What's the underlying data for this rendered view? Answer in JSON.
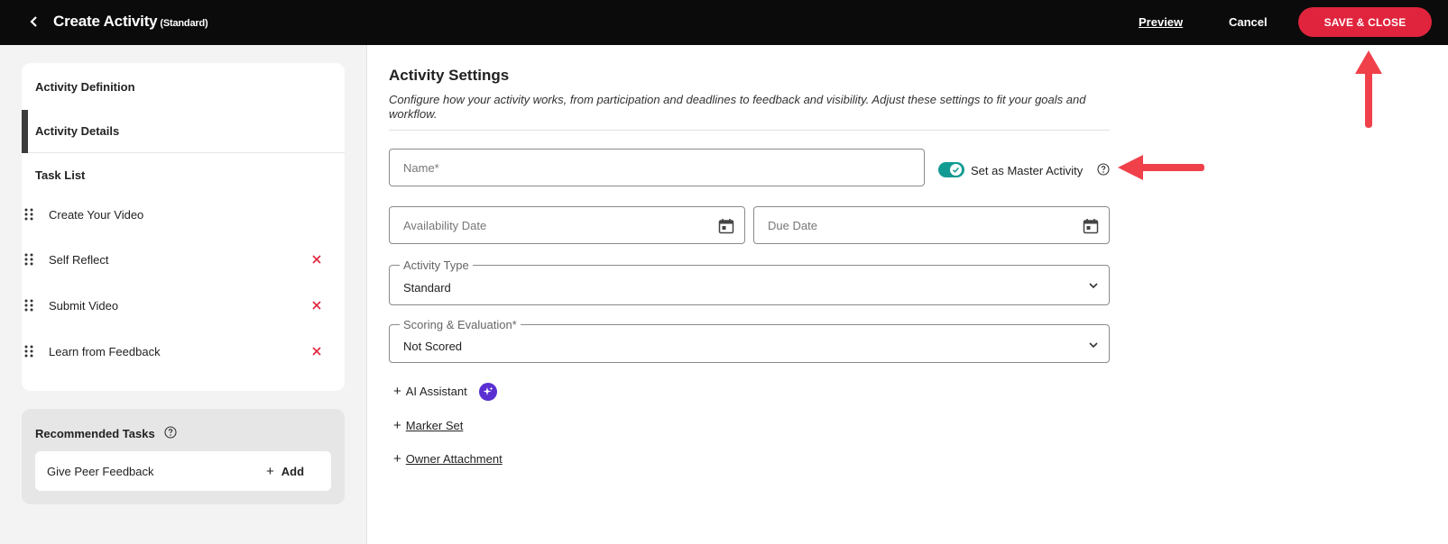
{
  "header": {
    "title": "Create Activity",
    "title_sub": "(Standard)",
    "preview_label": "Preview",
    "cancel_label": "Cancel",
    "save_label": "SAVE & CLOSE",
    "save_color": "#e0243d"
  },
  "sidebar": {
    "nav": {
      "definition": "Activity Definition",
      "details": "Activity Details",
      "task_list": "Task List"
    },
    "tasks": [
      {
        "label": "Create Your Video",
        "removable": false
      },
      {
        "label": "Self Reflect",
        "removable": true
      },
      {
        "label": "Submit Video",
        "removable": true
      },
      {
        "label": "Learn from Feedback",
        "removable": true
      }
    ],
    "recommended": {
      "title": "Recommended Tasks",
      "item_label": "Give Peer Feedback",
      "add_label": "Add"
    }
  },
  "main": {
    "title": "Activity Settings",
    "description": "Configure how your activity works, from participation and deadlines to feedback and visibility. Adjust these settings to fit your goals and workflow.",
    "name_placeholder": "Name*",
    "master_label": "Set as Master Activity",
    "master_enabled": true,
    "toggle_color": "#139b93",
    "availability_placeholder": "Availability Date",
    "due_placeholder": "Due Date",
    "activity_type": {
      "legend": "Activity Type",
      "value": "Standard"
    },
    "scoring": {
      "legend": "Scoring & Evaluation*",
      "value": "Not Scored"
    },
    "links": {
      "ai_assistant": "AI Assistant",
      "marker_set": "Marker Set",
      "owner_attachment": "Owner Attachment"
    }
  },
  "icons": {
    "back": "chevron-left-icon",
    "calendar": "calendar-icon",
    "chevron": "chevron-down-icon",
    "help": "help-circle-icon",
    "grip": "drag-handle-icon",
    "remove": "close-icon",
    "ai": "sparkle-icon"
  },
  "annotation_color": "#f0414b"
}
